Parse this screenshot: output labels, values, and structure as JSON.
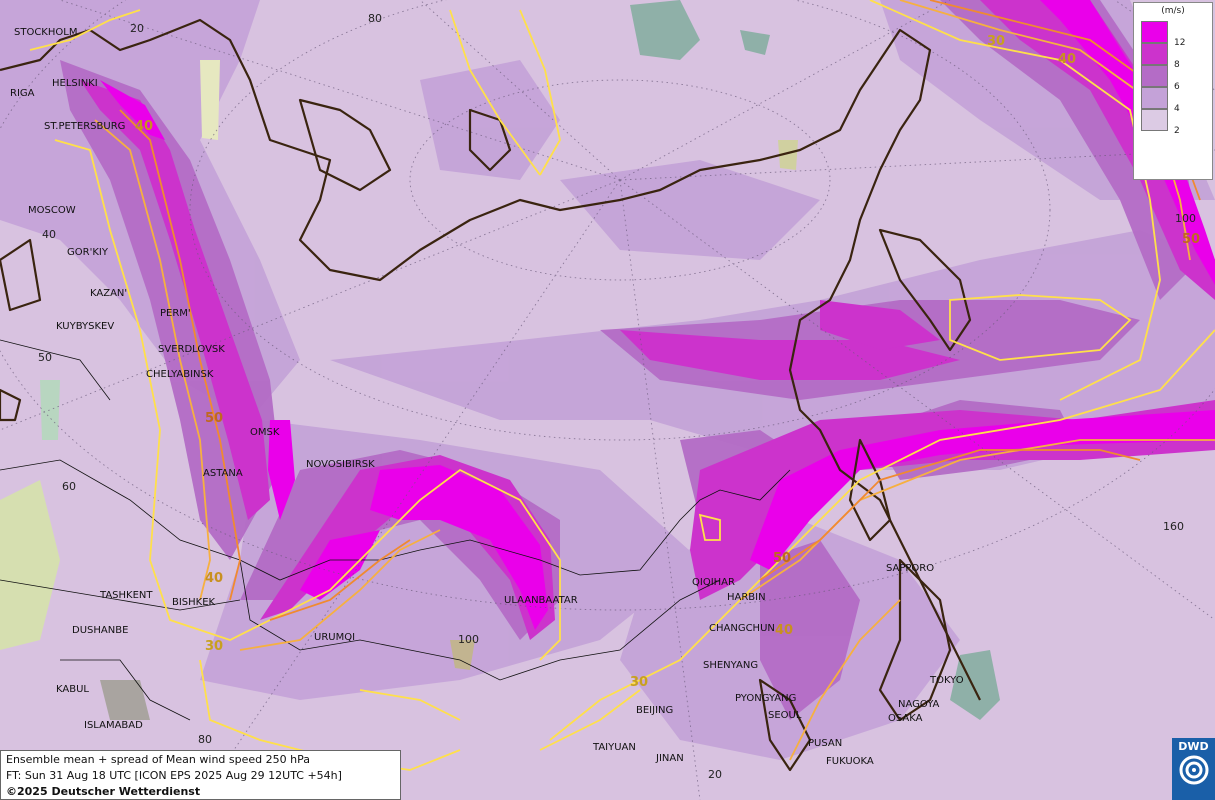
{
  "legend": {
    "unit": "(m/s)",
    "levels": [
      {
        "label": "12",
        "color": "#ea00ea"
      },
      {
        "label": "8",
        "color": "#cc33cc"
      },
      {
        "label": "6",
        "color": "#b46cc6"
      },
      {
        "label": "4",
        "color": "#c4a2d8"
      },
      {
        "label": "2",
        "color": "#dccbe4"
      }
    ]
  },
  "info": {
    "line1": "Ensemble mean + spread of Mean wind speed 250 hPa",
    "line2": "FT: Sun 31 Aug 18 UTC [ICON EPS 2025 Aug 29 12UTC +54h]",
    "line3": "©2025 Deutscher Wetterdienst"
  },
  "logo": {
    "text": "DWD"
  },
  "cities": {
    "stockholm": "STOCKHOLM",
    "helsinki": "HELSINKI",
    "riga": "RIGA",
    "st_petersburg": "ST.PETERSBURG",
    "moscow": "MOSCOW",
    "gorkiy": "GOR'KIY",
    "kazan": "KAZAN'",
    "perm": "PERM'",
    "kuybyshev": "KUYBYSKEV",
    "sverdlovsk": "SVERDLOVSK",
    "chelyabinsk": "CHELYABINSK",
    "omsk": "OMSK",
    "astana": "ASTANA",
    "novosibirsk": "NOVOSIBIRSK",
    "tashkent": "TASHKENT",
    "bishkek": "BISHKEK",
    "dushanbe": "DUSHANBE",
    "urumqi": "URUMQI",
    "ulaanbaatar": "ULAANBAATAR",
    "kabul": "KABUL",
    "islamabad": "ISLAMABAD",
    "qiqihar": "QIQIHAR",
    "harbin": "HARBIN",
    "changchun": "CHANGCHUN",
    "shenyang": "SHENYANG",
    "pyongyang": "PYONGYANG",
    "seoul": "SEOUL",
    "beijing": "BEIJING",
    "taiyuan": "TAIYUAN",
    "jinan": "JINAN",
    "pusan": "PUSAN",
    "fukuoka": "FUKUOKA",
    "sapporo": "SAPPORO",
    "tokyo": "TOKYO",
    "nagoya": "NAGOYA",
    "osaka": "OSAKA"
  },
  "grid_labels": {
    "g20top": "20",
    "g80top": "80",
    "g40": "40",
    "g50": "50",
    "g60": "60",
    "g80bot": "80",
    "g100": "100",
    "g20bot": "20",
    "g160": "160",
    "g100r": "100"
  },
  "iso_labels": {
    "a": "40",
    "b": "50",
    "c": "40",
    "d": "30",
    "e": "30",
    "f": "40",
    "g": "50",
    "h": "30",
    "i": "50",
    "j": "40"
  }
}
